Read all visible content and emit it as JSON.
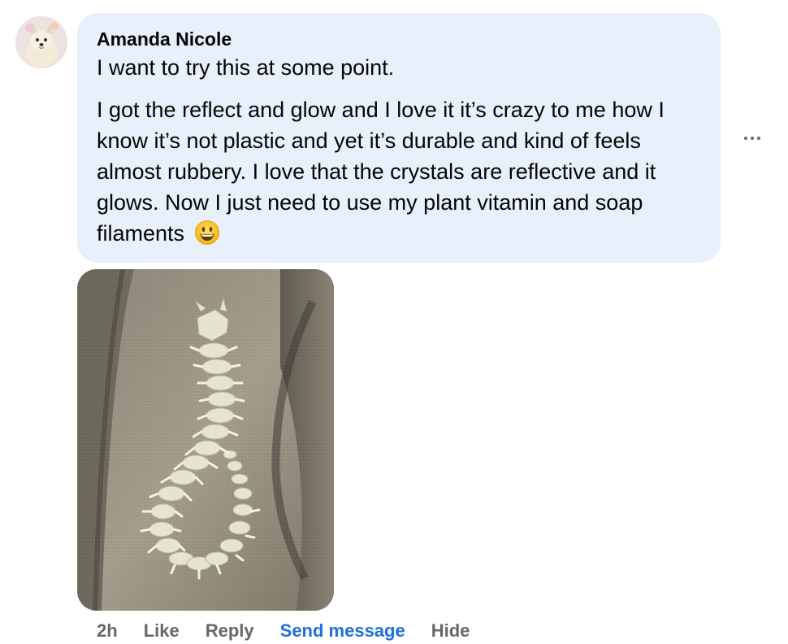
{
  "comment": {
    "author": "Amanda Nicole",
    "paragraphs": [
      "I want to try this at some point.",
      "I got the reflect and glow and I love it it’s crazy to me how I know it’s not plastic and yet it’s durable and kind of feels almost rubbery. I love that the crystals are reflective and it glows. Now I just need to use my plant vitamin and soap filaments"
    ],
    "emoji": "grinning-face-emoji",
    "avatar_icon": "dog-avatar-icon",
    "photo_icon": "printed-dragon-photo",
    "more_icon": "more-options-icon"
  },
  "actions": {
    "time": "2h",
    "like": "Like",
    "reply": "Reply",
    "send_message": "Send message",
    "hide": "Hide"
  },
  "colors": {
    "bubble": "#e7f0fb",
    "text": "#050505",
    "secondary": "#65676b",
    "link": "#1f6fde"
  }
}
